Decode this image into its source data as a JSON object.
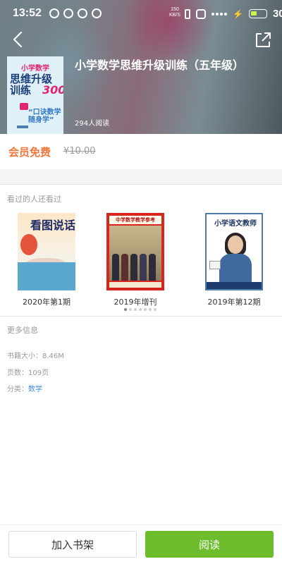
{
  "status_bar": {
    "time": "13:52",
    "net_speed_value": "150",
    "net_speed_unit": "KB/S",
    "battery_level": "30"
  },
  "header": {
    "book_title": "小学数学思维升级训练（五年级）",
    "read_count": "294人阅读",
    "cover": {
      "line1": "小学数学",
      "line2": "思维升级",
      "line3": "训练",
      "number": "300",
      "slogan1": "“口诀数学",
      "slogan2": "随身学”"
    }
  },
  "pricing": {
    "vip_label": "会员免费",
    "original_price": "¥10.00"
  },
  "recommendations": {
    "title": "看过的人还看过",
    "items": [
      {
        "caption": "2020年第1期",
        "cover_text": "看图说话"
      },
      {
        "caption": "2019年增刊",
        "cover_text": "中学数学教学参考"
      },
      {
        "caption": "2019年第12期",
        "cover_text": "小学语文教师"
      }
    ],
    "page_count": 7,
    "active_page": 0
  },
  "more_info": {
    "title": "更多信息",
    "size_label": "书籍大小：",
    "size_value": "8.46M",
    "pages_label": "页数：",
    "pages_value": "109页",
    "category_label": "分类：",
    "category_value": "数学"
  },
  "actions": {
    "add_to_shelf": "加入书架",
    "read": "阅读"
  },
  "colors": {
    "accent_green": "#6cbc2c",
    "vip_orange": "#f0773a",
    "link_blue": "#3d8be0"
  }
}
